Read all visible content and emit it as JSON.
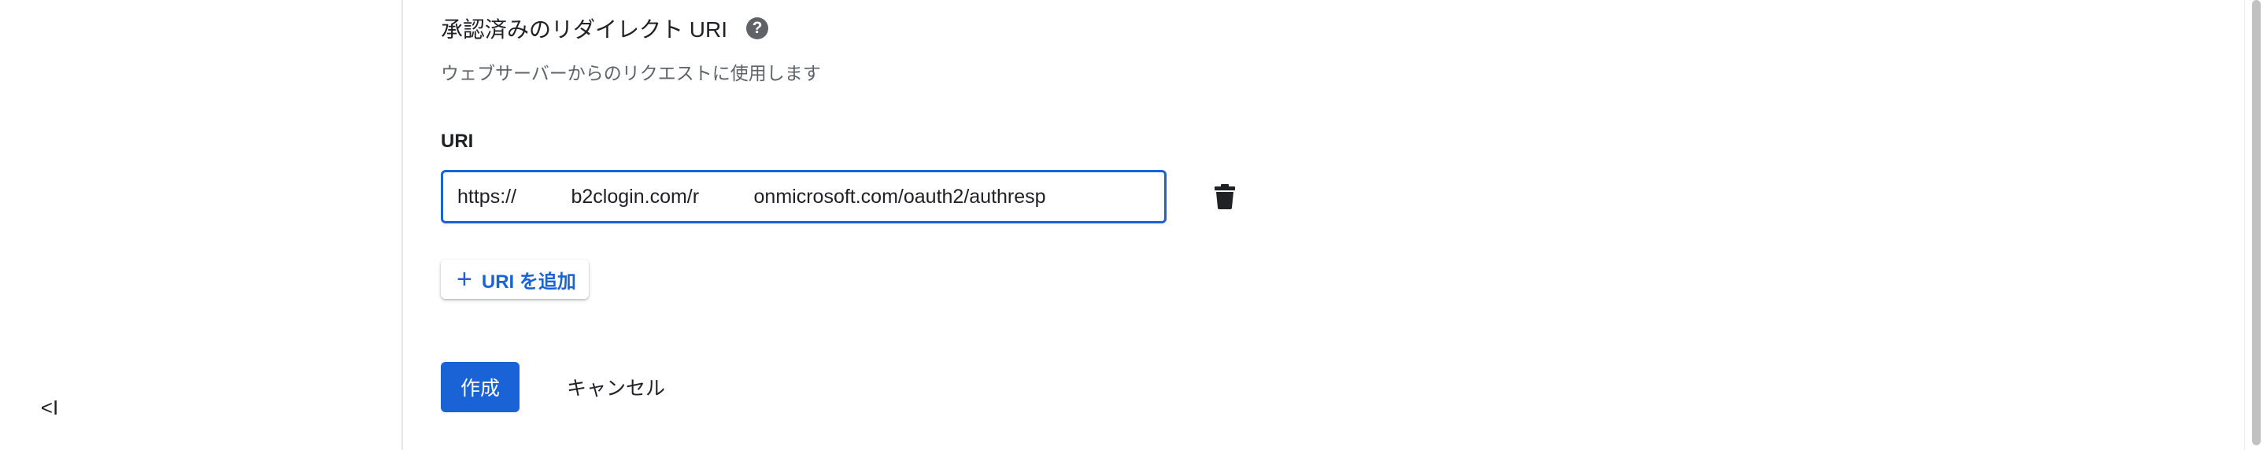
{
  "sidebar": {
    "collapse_label": "<I"
  },
  "redirect_section": {
    "title": "承認済みのリダイレクト URI",
    "help_icon": "?",
    "description": "ウェブサーバーからのリクエストに使用します",
    "field_label": "URI",
    "uri_value": "https://          b2clogin.com/r          onmicrosoft.com/oauth2/authresp",
    "add_uri_label": "URI を追加"
  },
  "actions": {
    "create_label": "作成",
    "cancel_label": "キャンセル"
  },
  "colors": {
    "accent": "#1a63d6",
    "text_primary": "#202124",
    "text_secondary": "#5f6368"
  }
}
